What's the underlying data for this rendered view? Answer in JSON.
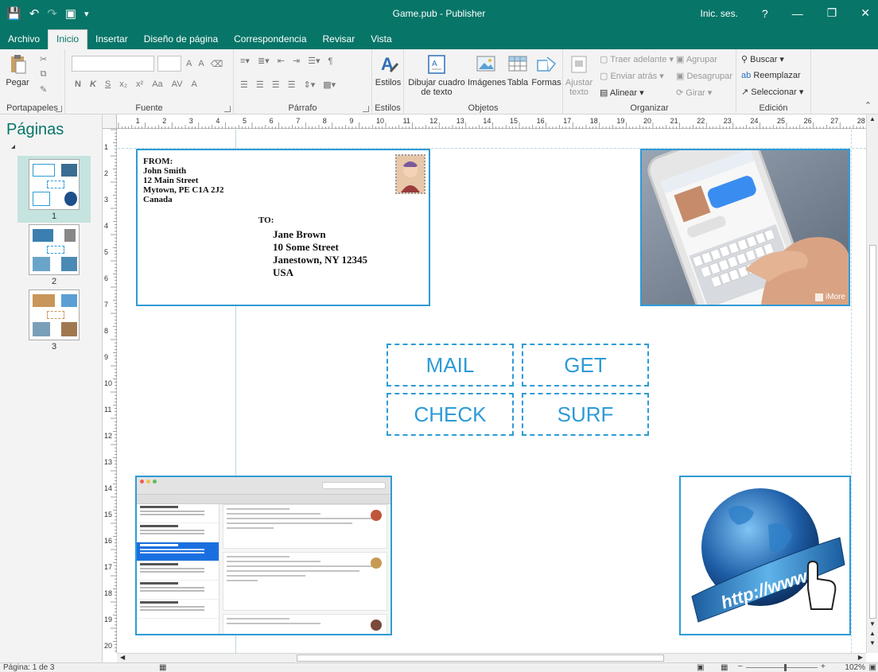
{
  "window": {
    "title": "Game.pub - Publisher",
    "sign_in": "Inic. ses.",
    "help": "?"
  },
  "tabs": [
    {
      "label": "Archivo",
      "active": false
    },
    {
      "label": "Inicio",
      "active": true
    },
    {
      "label": "Insertar",
      "active": false
    },
    {
      "label": "Diseño de página",
      "active": false
    },
    {
      "label": "Correspondencia",
      "active": false
    },
    {
      "label": "Revisar",
      "active": false
    },
    {
      "label": "Vista",
      "active": false
    }
  ],
  "ribbon": {
    "clipboard": {
      "label": "Portapapeles",
      "paste": "Pegar"
    },
    "font": {
      "label": "Fuente",
      "bold": "N",
      "italic": "K",
      "underline": "S",
      "subscript": "x₂",
      "superscript": "x²",
      "case": "Aa",
      "spacing": "AV",
      "color": "A",
      "grow": "A",
      "shrink": "A"
    },
    "paragraph": {
      "label": "Párrafo",
      "pilcrow": "¶"
    },
    "styles": {
      "label": "Estilos",
      "styles_btn": "Estilos"
    },
    "objects": {
      "label": "Objetos",
      "textbox_line1": "Dibujar cuadro",
      "textbox_line2": "de texto",
      "images": "Imágenes",
      "table": "Tabla",
      "shapes": "Formas"
    },
    "arrange": {
      "label": "Organizar",
      "wrap_line1": "Ajustar",
      "wrap_line2": "texto",
      "bring_forward": "Traer adelante",
      "send_backward": "Enviar atrás",
      "align": "Alinear",
      "group": "Agrupar",
      "ungroup": "Desagrupar",
      "rotate": "Girar"
    },
    "editing": {
      "label": "Edición",
      "find": "Buscar",
      "replace": "Reemplazar",
      "select": "Seleccionar"
    }
  },
  "pages_pane": {
    "title": "Páginas",
    "pages": [
      {
        "number": "1",
        "selected": true
      },
      {
        "number": "2",
        "selected": false
      },
      {
        "number": "3",
        "selected": false
      }
    ]
  },
  "rulers": {
    "horizontal": [
      "1",
      "2",
      "3",
      "4",
      "5",
      "6",
      "7",
      "8",
      "9",
      "10",
      "11",
      "12",
      "13",
      "14",
      "15",
      "16",
      "17",
      "18",
      "19",
      "20",
      "21",
      "22",
      "23",
      "24",
      "25",
      "26",
      "27",
      "28"
    ],
    "vertical": [
      "1",
      "2",
      "3",
      "4",
      "5",
      "6",
      "7",
      "8",
      "9",
      "10",
      "11",
      "12",
      "13",
      "14",
      "15",
      "16",
      "17",
      "18",
      "19",
      "20"
    ]
  },
  "envelope": {
    "from_label": "FROM:",
    "from_lines": [
      "John Smith",
      "12 Main Street",
      "Mytown, PE  C1A 2J2",
      "Canada"
    ],
    "to_label": "TO:",
    "to_lines": [
      "Jane Brown",
      "10 Some Street",
      "Janestown, NY  12345",
      "USA"
    ]
  },
  "phone_image": {
    "watermark": "iMore"
  },
  "internet_image": {
    "text": "http://www."
  },
  "word_tiles": [
    "MAIL",
    "GET",
    "CHECK",
    "SURF"
  ],
  "status": {
    "page_info": "Página: 1 de 3",
    "zoom": "102%"
  },
  "colors": {
    "accent": "#077568",
    "selection": "#2e9bd6"
  }
}
